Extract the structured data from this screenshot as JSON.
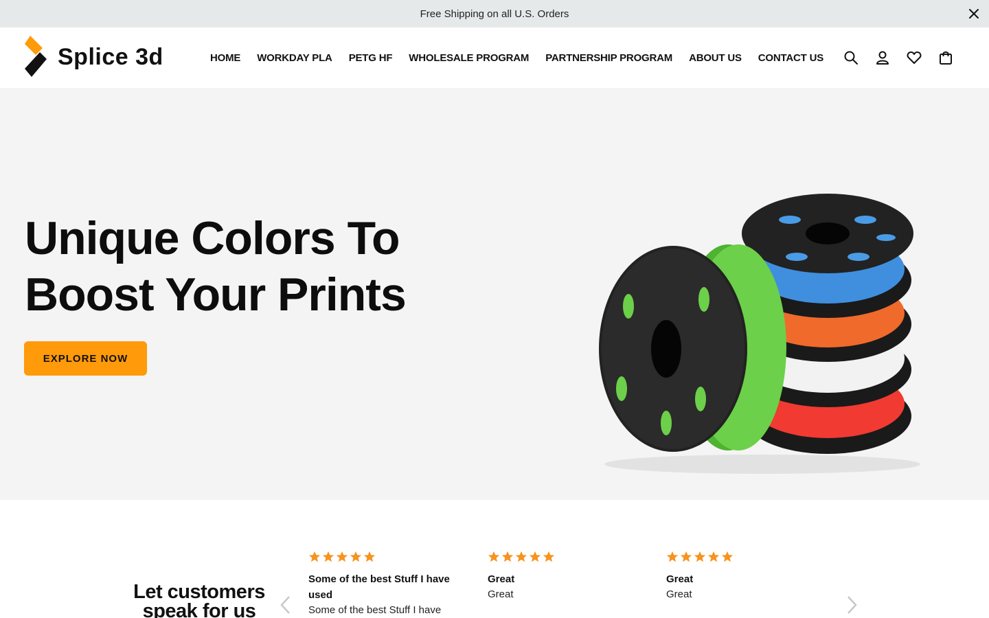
{
  "announcement": {
    "text": "Free Shipping on all U.S. Orders"
  },
  "brand": {
    "name": "Splice 3d",
    "accent": "#ff9a0a"
  },
  "nav": {
    "items": [
      {
        "label": "HOME"
      },
      {
        "label": "WORKDAY PLA"
      },
      {
        "label": "PETG HF"
      },
      {
        "label": "WHOLESALE PROGRAM"
      },
      {
        "label": "PARTNERSHIP PROGRAM"
      },
      {
        "label": "ABOUT US"
      },
      {
        "label": "CONTACT US"
      }
    ]
  },
  "header_actions": [
    "search-icon",
    "account-icon",
    "wishlist-icon",
    "cart-icon"
  ],
  "hero": {
    "title_line1": "Unique Colors To",
    "title_line2": "Boost Your Prints",
    "cta": "EXPLORE NOW",
    "spool_colors": [
      "#6cd04a",
      "#3f8fde",
      "#f06a2c",
      "#f2f2f2",
      "#f03a32"
    ]
  },
  "reviews": {
    "heading_line1": "Let customers",
    "heading_line2": "speak for us",
    "star_color": "#f7931e",
    "items": [
      {
        "rating": 5,
        "title": "Some of the best Stuff I have used",
        "body": "Some of the best Stuff I have"
      },
      {
        "rating": 5,
        "title": "Great",
        "body": "Great"
      },
      {
        "rating": 5,
        "title": "Great",
        "body": "Great"
      }
    ]
  }
}
